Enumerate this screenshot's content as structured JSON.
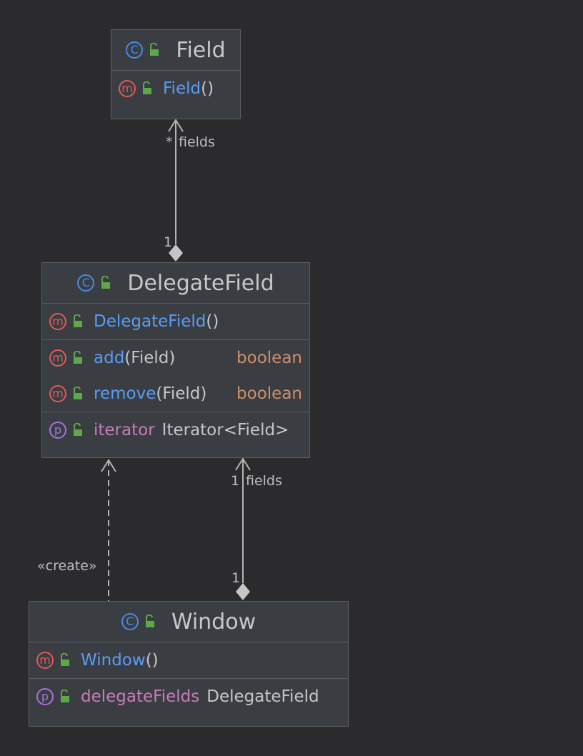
{
  "classes": {
    "field": {
      "name": "Field",
      "kind_badge": "C",
      "members": [
        {
          "badge": "m",
          "name": "Field",
          "suffix": "()"
        }
      ]
    },
    "delegate_field": {
      "name": "DelegateField",
      "kind_badge": "C",
      "constructor": {
        "badge": "m",
        "name": "DelegateField",
        "suffix": "()"
      },
      "methods": [
        {
          "badge": "m",
          "name": "add",
          "params": "(Field)",
          "returns": "boolean"
        },
        {
          "badge": "m",
          "name": "remove",
          "params": "(Field)",
          "returns": "boolean"
        }
      ],
      "properties": [
        {
          "badge": "p",
          "name": "iterator",
          "type": "Iterator<Field>"
        }
      ]
    },
    "window": {
      "name": "Window",
      "kind_badge": "C",
      "constructor": {
        "badge": "m",
        "name": "Window",
        "suffix": "()"
      },
      "properties": [
        {
          "badge": "p",
          "name": "delegateFields",
          "type": "DelegateField"
        }
      ]
    }
  },
  "relations": {
    "delegate_to_field": {
      "target_multiplicity": "*",
      "target_role": "fields",
      "source_multiplicity": "1"
    },
    "window_to_delegate": {
      "target_multiplicity": "1",
      "target_role": "fields",
      "source_multiplicity": "1"
    },
    "window_creates_delegate": {
      "stereotype": "«create»"
    }
  },
  "colors": {
    "background": "#2b2b2e",
    "box_fill": "#3a3d41",
    "box_border": "#5a5d61",
    "class_badge": "#4a8ae8",
    "method_badge": "#e35a5a",
    "property_badge": "#a772e0",
    "method_name": "#589df6",
    "property_name": "#c77dbb",
    "return_type": "#cf8e6d",
    "public_lock": "#5fa84a",
    "edge": "#b4b4b4"
  }
}
